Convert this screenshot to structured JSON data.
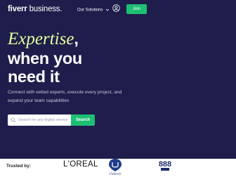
{
  "brand": {
    "logo": "fiverr",
    "suffix": " business."
  },
  "nav": {
    "menu_label": "Our Solutions",
    "join_label": "Join"
  },
  "hero": {
    "headline_accent": "Expertise",
    "headline_comma": ",",
    "headline_line2": "when you",
    "headline_line3": "need it",
    "subtitle": "Connect with vetted experts, execute every project, and expand your team capabilities"
  },
  "search": {
    "placeholder": "Search for any digital service",
    "button_label": "Search"
  },
  "trusted": {
    "label": "Trusted by:",
    "logos": [
      "L'OREAL",
      "Unilever",
      "888"
    ]
  },
  "colors": {
    "hero_bg": "#1f1d4b",
    "accent_green": "#1dbf73",
    "headline_accent": "#e5ff9f"
  }
}
